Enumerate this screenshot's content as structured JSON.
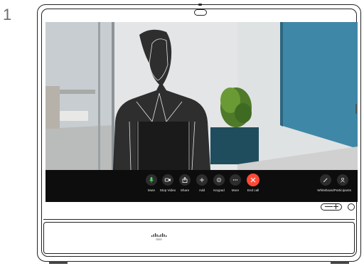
{
  "step_number": "1",
  "device": {
    "brand_logo": "cisco"
  },
  "call_controls": {
    "left": [
      {
        "id": "mute",
        "label": "Mute",
        "icon": "microphone-icon",
        "color": "#2d2d2d",
        "icon_color": "#4cd964"
      },
      {
        "id": "stop-video",
        "label": "Stop Video",
        "icon": "video-camera-icon",
        "color": "#2d2d2d",
        "icon_color": "#ffffff"
      },
      {
        "id": "share",
        "label": "Share",
        "icon": "share-icon",
        "color": "#2d2d2d",
        "icon_color": "#ffffff"
      },
      {
        "id": "add",
        "label": "Add",
        "icon": "plus-icon",
        "color": "#2d2d2d",
        "icon_color": "#ffffff"
      },
      {
        "id": "keypad",
        "label": "Keypad",
        "icon": "keypad-icon",
        "color": "#2d2d2d",
        "icon_color": "#ffffff"
      },
      {
        "id": "more",
        "label": "More",
        "icon": "more-icon",
        "color": "#2d2d2d",
        "icon_color": "#ffffff"
      },
      {
        "id": "end-call",
        "label": "End call",
        "icon": "close-icon",
        "color": "#ff4a36",
        "icon_color": "#ffffff"
      }
    ],
    "right": [
      {
        "id": "whiteboard",
        "label": "Whiteboard",
        "icon": "pencil-icon",
        "color": "#2d2d2d",
        "icon_color": "#ffffff"
      },
      {
        "id": "participants",
        "label": "Participants",
        "icon": "person-icon",
        "color": "#2d2d2d",
        "icon_color": "#ffffff"
      }
    ]
  }
}
